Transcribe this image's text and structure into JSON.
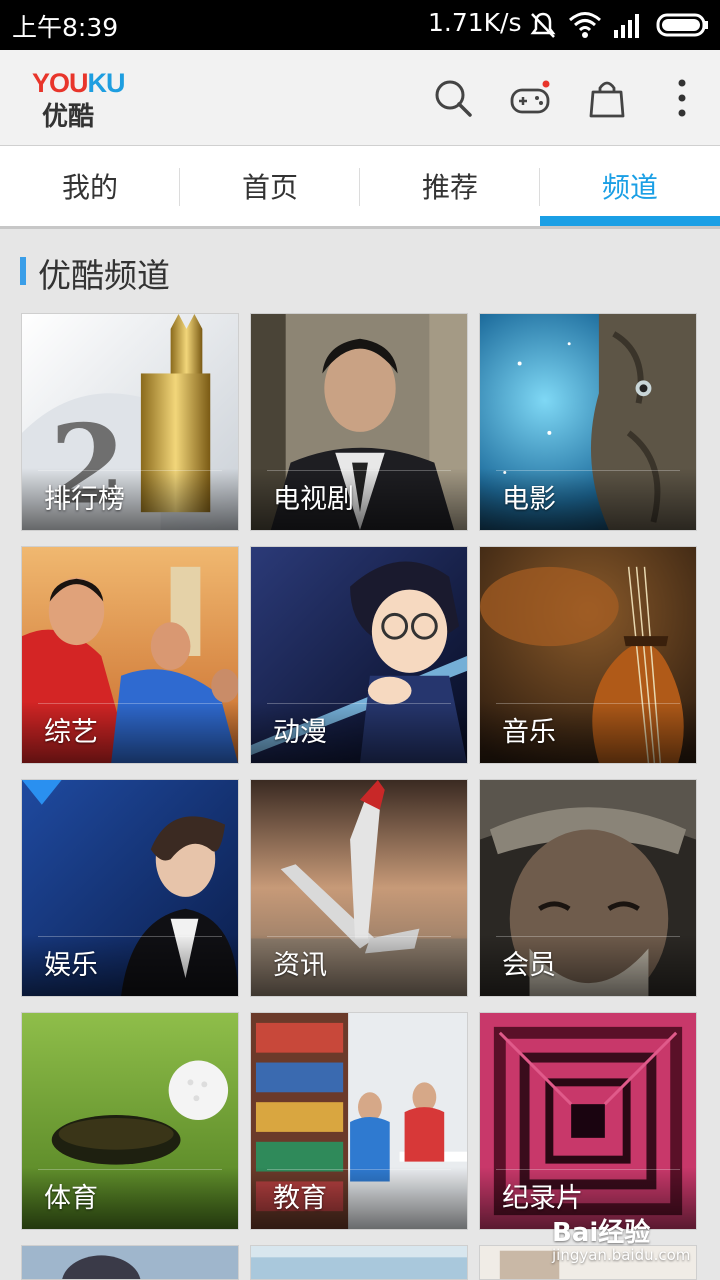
{
  "status_bar": {
    "time": "上午8:39",
    "network_speed": "1.71K/s",
    "icons": [
      "mute-icon",
      "wifi-icon",
      "signal-icon",
      "battery-icon"
    ]
  },
  "app_bar": {
    "logo_en": {
      "part1": "YOU",
      "part2": "KU"
    },
    "logo_cn": "优酷",
    "actions": [
      "search-icon",
      "game-icon",
      "shopping-bag-icon",
      "more-icon"
    ],
    "game_has_notification": true
  },
  "tabs": [
    {
      "label": "我的",
      "active": false
    },
    {
      "label": "首页",
      "active": false
    },
    {
      "label": "推荐",
      "active": false
    },
    {
      "label": "频道",
      "active": true
    }
  ],
  "section": {
    "title": "优酷频道"
  },
  "channels": [
    {
      "label": "排行榜",
      "art": "ranking"
    },
    {
      "label": "电视剧",
      "art": "tv-series"
    },
    {
      "label": "电影",
      "art": "movie"
    },
    {
      "label": "综艺",
      "art": "variety"
    },
    {
      "label": "动漫",
      "art": "anime"
    },
    {
      "label": "音乐",
      "art": "music"
    },
    {
      "label": "娱乐",
      "art": "entertainment"
    },
    {
      "label": "资讯",
      "art": "news"
    },
    {
      "label": "会员",
      "art": "membership"
    },
    {
      "label": "体育",
      "art": "sports"
    },
    {
      "label": "教育",
      "art": "education"
    },
    {
      "label": "纪录片",
      "art": "documentary"
    }
  ],
  "watermark": {
    "main": "Bai经验",
    "sub": "jingyan.baidu.com"
  },
  "colors": {
    "accent": "#1a9fe5",
    "brand_red": "#e8352b",
    "brand_blue": "#1e9ee0"
  }
}
